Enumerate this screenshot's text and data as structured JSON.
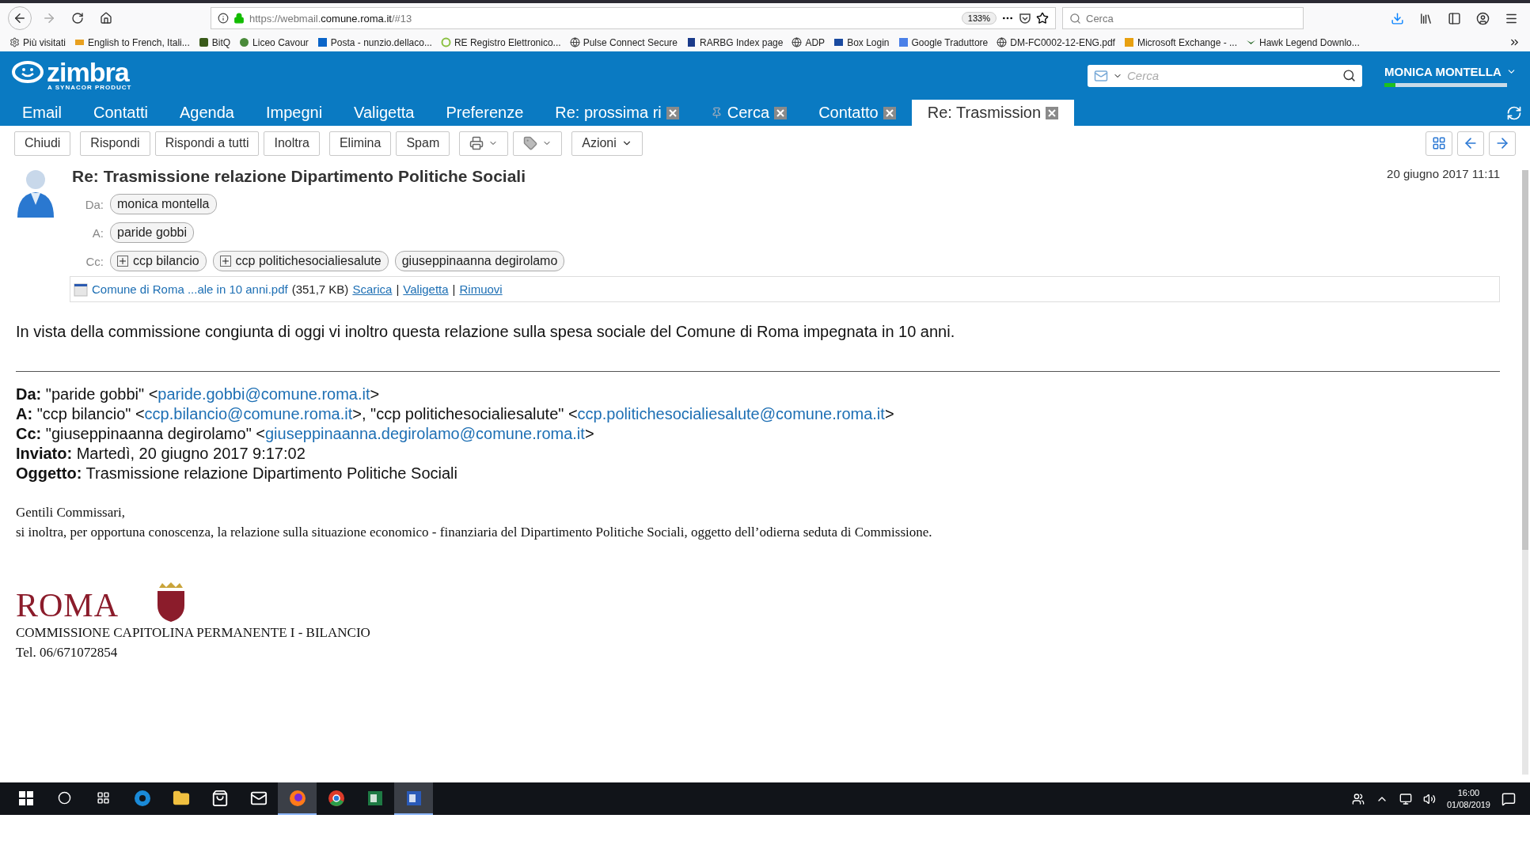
{
  "browser": {
    "url_prefix": "https://webmail.",
    "url_domain": "comune.roma.it",
    "url_suffix": "/#13",
    "zoom": "133%",
    "search_placeholder": "Cerca",
    "bookmarks": [
      {
        "label": "Più visitati",
        "kind": "gear"
      },
      {
        "label": "English to French, Itali...",
        "kind": "wr"
      },
      {
        "label": "BitQ",
        "kind": "bitq"
      },
      {
        "label": "Liceo Cavour",
        "kind": "emblem"
      },
      {
        "label": "Posta - nunzio.dellaco...",
        "kind": "outlook"
      },
      {
        "label": "RE Registro Elettronico...",
        "kind": "re"
      },
      {
        "label": "Pulse Connect Secure",
        "kind": "globe"
      },
      {
        "label": "RARBG Index page",
        "kind": "r"
      },
      {
        "label": "ADP",
        "kind": "globe"
      },
      {
        "label": "Box Login",
        "kind": "box"
      },
      {
        "label": "Google Traduttore",
        "kind": "translate"
      },
      {
        "label": "DM-FC0002-12-ENG.pdf",
        "kind": "globe"
      },
      {
        "label": "Microsoft Exchange - ...",
        "kind": "exchange"
      },
      {
        "label": "Hawk Legend Downlo...",
        "kind": "hawk"
      }
    ]
  },
  "app": {
    "logo_word": "zimbra",
    "logo_tagline": "A SYNACOR PRODUCT",
    "search_placeholder": "Cerca",
    "user": "MONICA MONTELLA",
    "quota": {
      "level": 0.09
    },
    "tabs": [
      {
        "label": "Email",
        "closable": false,
        "pinned": false,
        "selected": false
      },
      {
        "label": "Contatti",
        "closable": false,
        "pinned": false,
        "selected": false
      },
      {
        "label": "Agenda",
        "closable": false,
        "pinned": false,
        "selected": false
      },
      {
        "label": "Impegni",
        "closable": false,
        "pinned": false,
        "selected": false
      },
      {
        "label": "Valigetta",
        "closable": false,
        "pinned": false,
        "selected": false
      },
      {
        "label": "Preferenze",
        "closable": false,
        "pinned": false,
        "selected": false
      },
      {
        "label": "Re: prossima ri",
        "closable": true,
        "pinned": false,
        "selected": false
      },
      {
        "label": "Cerca",
        "closable": true,
        "pinned": true,
        "selected": false
      },
      {
        "label": "Contatto",
        "closable": true,
        "pinned": false,
        "selected": false
      },
      {
        "label": "Re: Trasmission",
        "closable": true,
        "pinned": false,
        "selected": true
      }
    ],
    "toolbar": [
      {
        "kind": "text",
        "label": "Chiudi"
      },
      {
        "kind": "text",
        "label": "Rispondi"
      },
      {
        "kind": "text",
        "label": "Rispondi a tutti"
      },
      {
        "kind": "text",
        "label": "Inoltra"
      },
      {
        "kind": "text",
        "label": "Elimina"
      },
      {
        "kind": "text",
        "label": "Spam"
      },
      {
        "kind": "print"
      },
      {
        "kind": "tag"
      },
      {
        "kind": "menu",
        "label": "Azioni"
      }
    ]
  },
  "message": {
    "subject": "Re: Trasmissione relazione Dipartimento Politiche Sociali",
    "date": "20 giugno 2017 11:11",
    "recipients": [
      {
        "label": "Da:",
        "people": [
          {
            "name": "monica montella",
            "expandable": false
          }
        ]
      },
      {
        "label": "A:",
        "people": [
          {
            "name": "paride gobbi",
            "expandable": false
          }
        ]
      },
      {
        "label": "Cc:",
        "people": [
          {
            "name": "ccp bilancio",
            "expandable": true
          },
          {
            "name": "ccp politichesocialiesalute",
            "expandable": true
          },
          {
            "name": "giuseppinaanna degirolamo",
            "expandable": false
          }
        ]
      }
    ],
    "attachment": {
      "name": "Comune di Roma ...ale in 10 anni.pdf",
      "size": "(351,7 KB)",
      "actions": [
        "Scarica",
        "Valigetta",
        "Rimuovi"
      ],
      "separator": "|"
    },
    "body": "In vista della commissione congiunta di oggi vi inoltro questa relazione sulla spesa sociale del Comune di Roma impegnata in 10 anni.",
    "quoted_header": [
      {
        "label": "Da:",
        "parts": [
          {
            "text": "\"paride gobbi\" <"
          },
          {
            "link": "paride.gobbi@comune.roma.it"
          },
          {
            "text": ">"
          }
        ]
      },
      {
        "label": "A:",
        "parts": [
          {
            "text": "\"ccp bilancio\" <"
          },
          {
            "link": "ccp.bilancio@comune.roma.it"
          },
          {
            "text": ">, \"ccp politichesocialiesalute\" <"
          },
          {
            "link": "ccp.politichesocialiesalute@comune.roma.it"
          },
          {
            "text": ">"
          }
        ]
      },
      {
        "label": "Cc:",
        "parts": [
          {
            "text": "\"giuseppinaanna degirolamo\" <"
          },
          {
            "link": "giuseppinaanna.degirolamo@comune.roma.it"
          },
          {
            "text": ">"
          }
        ]
      },
      {
        "label": "Inviato:",
        "parts": [
          {
            "text": "Martedì, 20 giugno 2017 9:17:02"
          }
        ]
      },
      {
        "label": "Oggetto:",
        "parts": [
          {
            "text": "Trasmissione relazione Dipartimento Politiche Sociali"
          }
        ]
      }
    ],
    "quoted_body": [
      "Gentili Commissari,",
      "si inoltra, per opportuna conoscenza, la relazione sulla situazione economico - finanziaria del Dipartimento Politiche Sociali, oggetto dell’odierna seduta di Commissione."
    ],
    "signature": {
      "logo_word": "ROMA",
      "lines": [
        "COMMISSIONE CAPITOLINA PERMANENTE I - BILANCIO",
        "Tel. 06/671072854"
      ]
    }
  },
  "taskbar": {
    "apps": [
      {
        "kind": "edge",
        "active": false
      },
      {
        "kind": "explorer",
        "active": false
      },
      {
        "kind": "store",
        "active": false
      },
      {
        "kind": "mail",
        "active": false
      },
      {
        "kind": "firefox",
        "active": true
      },
      {
        "kind": "chrome",
        "active": false
      },
      {
        "kind": "excel",
        "active": false
      },
      {
        "kind": "word",
        "active": true
      }
    ],
    "time": "16:00",
    "date": "01/08/2019"
  }
}
